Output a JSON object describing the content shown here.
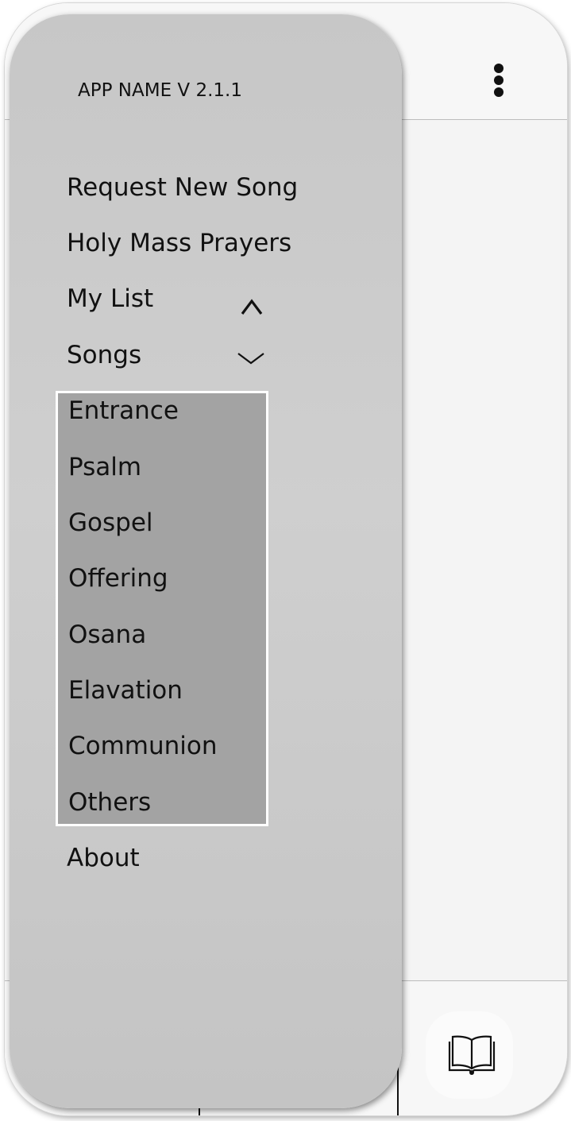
{
  "drawer": {
    "app_name": "APP NAME V 2.1.1",
    "items": [
      {
        "label": "Request New Song"
      },
      {
        "label": "Holy Mass Prayers"
      },
      {
        "label": "My List"
      },
      {
        "label": "Songs"
      }
    ],
    "songs_submenu": [
      {
        "label": "Entrance"
      },
      {
        "label": "Psalm"
      },
      {
        "label": "Gospel"
      },
      {
        "label": "Offering"
      },
      {
        "label": "Osana"
      },
      {
        "label": "Elavation"
      },
      {
        "label": "Communion"
      },
      {
        "label": "Others"
      }
    ],
    "about": {
      "label": "About"
    }
  },
  "icons": {
    "overflow": "more-vertical-icon",
    "my_list_toggle": "chevron-up-icon",
    "songs_toggle": "chevron-down-icon",
    "bottom_nav": "book-open-icon"
  },
  "colors": {
    "drawer_bg": "#c9c9c9",
    "submenu_bg": "#a3a3a3",
    "text": "#111111"
  }
}
